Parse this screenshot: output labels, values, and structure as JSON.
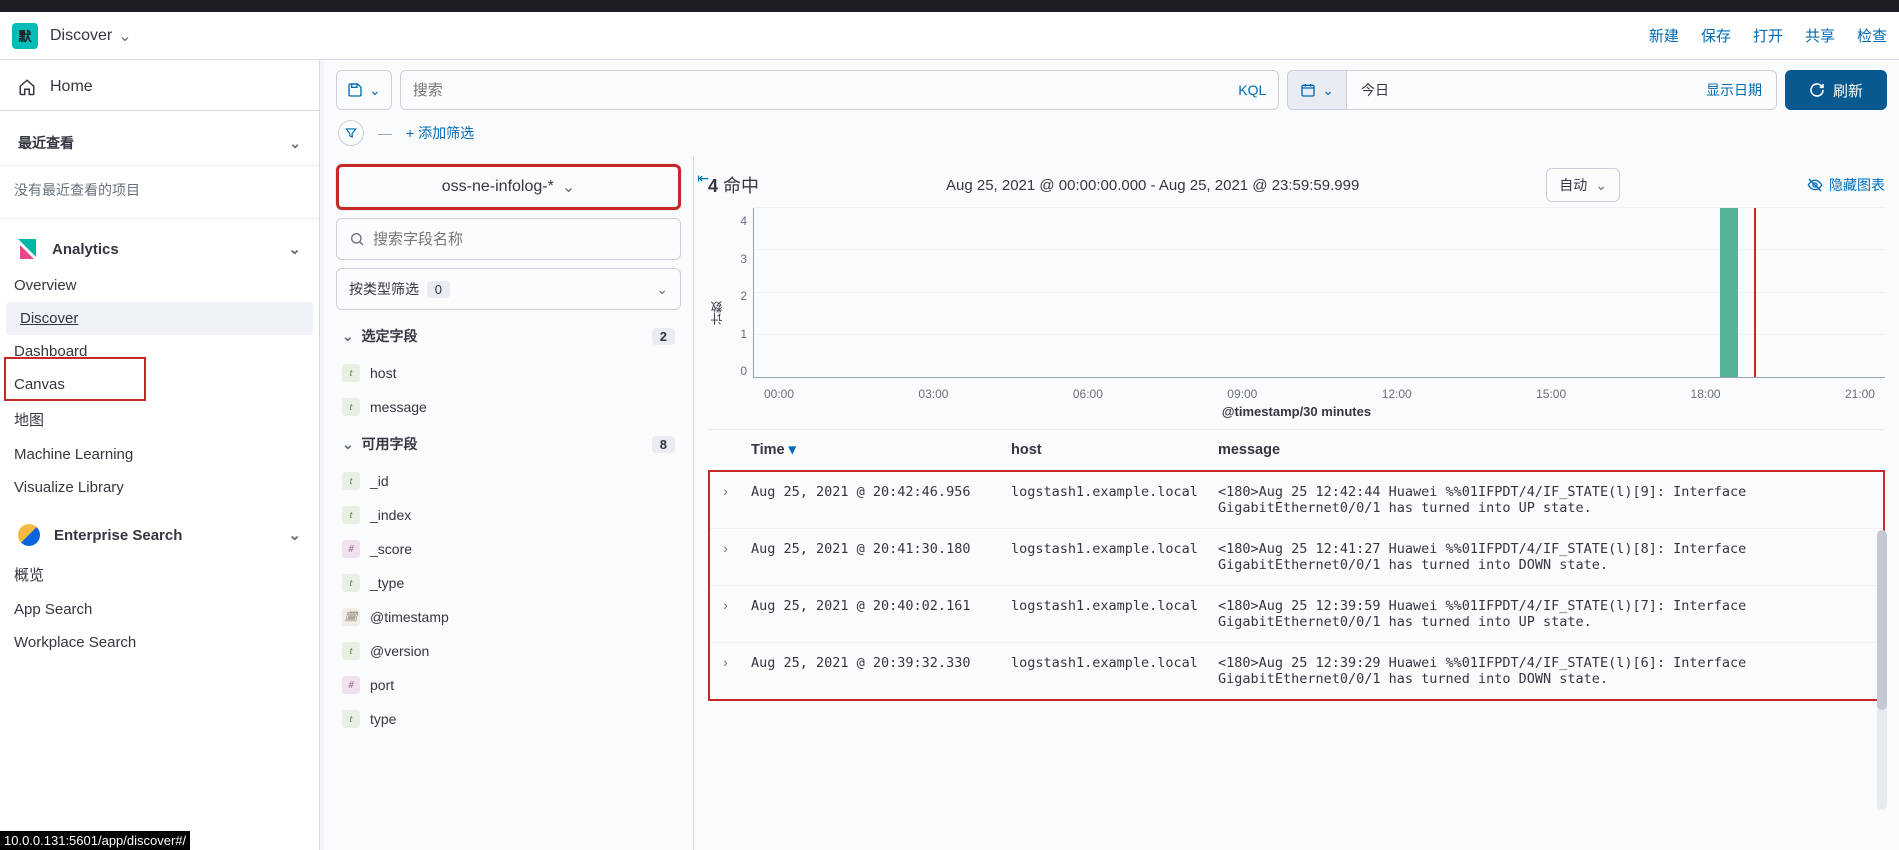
{
  "header": {
    "logo_text": "默",
    "app": "Discover",
    "links": [
      "新建",
      "保存",
      "打开",
      "共享",
      "检查"
    ]
  },
  "sidebar": {
    "home": "Home",
    "recent_title": "最近查看",
    "recent_empty": "没有最近查看的项目",
    "analytics": {
      "title": "Analytics",
      "items": [
        "Overview",
        "Discover",
        "Dashboard",
        "Canvas",
        "地图",
        "Machine Learning",
        "Visualize Library"
      ]
    },
    "enterprise": {
      "title": "Enterprise Search",
      "items": [
        "概览",
        "App Search",
        "Workplace Search"
      ]
    }
  },
  "toolbar": {
    "search_placeholder": "搜索",
    "kql": "KQL",
    "date_quick": "今日",
    "show_dates": "显示日期",
    "refresh": "刷新",
    "add_filter": "+ 添加筛选"
  },
  "fields": {
    "pattern": "oss-ne-infolog-*",
    "search_placeholder": "搜索字段名称",
    "type_filter_label": "按类型筛选",
    "type_filter_count": "0",
    "selected_label": "选定字段",
    "selected_count": "2",
    "selected": [
      {
        "t": "t",
        "name": "host"
      },
      {
        "t": "t",
        "name": "message"
      }
    ],
    "available_label": "可用字段",
    "available_count": "8",
    "available": [
      {
        "t": "t",
        "name": "_id"
      },
      {
        "t": "t",
        "name": "_index"
      },
      {
        "t": "h",
        "name": "_score"
      },
      {
        "t": "t",
        "name": "_type"
      },
      {
        "t": "d",
        "name": "@timestamp"
      },
      {
        "t": "t",
        "name": "@version"
      },
      {
        "t": "h",
        "name": "port"
      },
      {
        "t": "t",
        "name": "type"
      }
    ]
  },
  "result": {
    "hits_value": "4",
    "hits_label": "命中",
    "range": "Aug 25, 2021 @ 00:00:00.000 - Aug 25, 2021 @ 23:59:59.999",
    "interval": "自动",
    "hide_chart": "隐藏图表",
    "chart_caption": "@timestamp/30 minutes",
    "columns": {
      "time": "Time",
      "host": "host",
      "message": "message"
    },
    "rows": [
      {
        "time": "Aug 25, 2021 @ 20:42:46.956",
        "host": "logstash1.example.local",
        "message": "<180>Aug 25 12:42:44 Huawei %%01IFPDT/4/IF_STATE(l)[9]: Interface GigabitEthernet0/0/1 has turned into UP state."
      },
      {
        "time": "Aug 25, 2021 @ 20:41:30.180",
        "host": "logstash1.example.local",
        "message": "<180>Aug 25 12:41:27 Huawei %%01IFPDT/4/IF_STATE(l)[8]: Interface GigabitEthernet0/0/1 has turned into DOWN state."
      },
      {
        "time": "Aug 25, 2021 @ 20:40:02.161",
        "host": "logstash1.example.local",
        "message": "<180>Aug 25 12:39:59 Huawei %%01IFPDT/4/IF_STATE(l)[7]: Interface GigabitEthernet0/0/1 has turned into UP state."
      },
      {
        "time": "Aug 25, 2021 @ 20:39:32.330",
        "host": "logstash1.example.local",
        "message": "<180>Aug 25 12:39:29 Huawei %%01IFPDT/4/IF_STATE(l)[6]: Interface GigabitEthernet0/0/1 has turned into DOWN state."
      }
    ]
  },
  "chart_data": {
    "type": "bar",
    "title": "@timestamp/30 minutes",
    "xlabel": "",
    "ylabel": "计数",
    "ylim": [
      0,
      4
    ],
    "x_ticks": [
      "00:00",
      "03:00",
      "06:00",
      "09:00",
      "12:00",
      "15:00",
      "18:00",
      "21:00"
    ],
    "y_ticks": [
      0,
      1,
      2,
      3,
      4
    ],
    "bars": [
      {
        "bucket": "20:30",
        "value": 4
      }
    ]
  },
  "status_url": "10.0.0.131:5601/app/discover#/"
}
